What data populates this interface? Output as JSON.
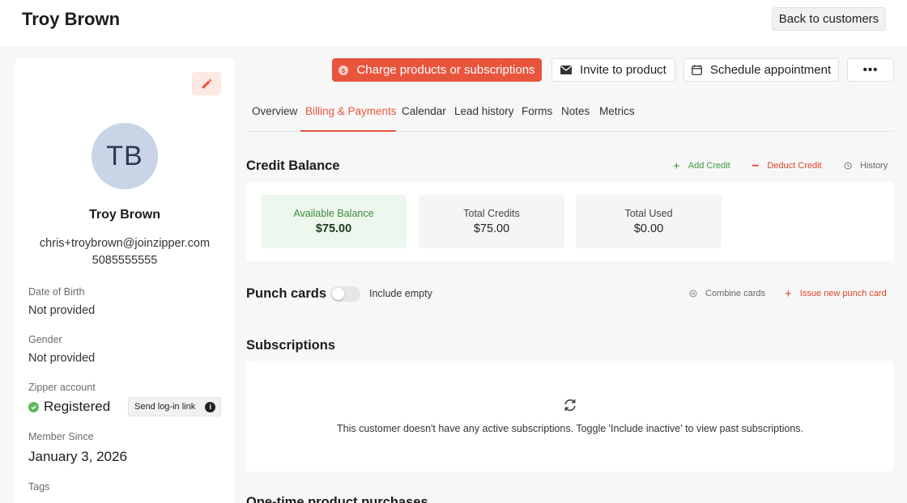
{
  "header": {
    "title": "Troy Brown",
    "back_label": "Back to customers"
  },
  "profile": {
    "initials": "TB",
    "name": "Troy Brown",
    "email": "chris+troybrown@joinzipper.com",
    "phone": "5085555555",
    "fields": {
      "dob_label": "Date of Birth",
      "dob_value": "Not provided",
      "gender_label": "Gender",
      "gender_value": "Not provided",
      "account_label": "Zipper account",
      "account_value": "Registered",
      "send_link_label": "Send log-in link",
      "member_label": "Member Since",
      "member_value": "January 3, 2026",
      "tags_label": "Tags"
    }
  },
  "actions": {
    "charge": "Charge products or subscriptions",
    "invite": "Invite to product",
    "schedule": "Schedule appointment",
    "more": "•••"
  },
  "tabs": [
    "Overview",
    "Billing & Payments",
    "Calendar",
    "Lead history",
    "Forms",
    "Notes",
    "Metrics"
  ],
  "active_tab": "Billing & Payments",
  "credit": {
    "title": "Credit Balance",
    "add": "Add Credit",
    "deduct": "Deduct Credit",
    "history": "History",
    "stats": [
      {
        "label": "Available Balance",
        "value": "$75.00"
      },
      {
        "label": "Total Credits",
        "value": "$75.00"
      },
      {
        "label": "Total Used",
        "value": "$0.00"
      }
    ]
  },
  "punch": {
    "title": "Punch cards",
    "toggle_label": "Include empty",
    "combine": "Combine cards",
    "issue": "Issue new punch card"
  },
  "subscriptions": {
    "title": "Subscriptions",
    "empty": "This customer doesn't have any active subscriptions. Toggle 'Include inactive' to view past subscriptions."
  },
  "one_time": {
    "title": "One-time product purchases"
  },
  "colors": {
    "accent": "#e8553d",
    "success": "#3a9a3a",
    "danger": "#e0432a"
  }
}
